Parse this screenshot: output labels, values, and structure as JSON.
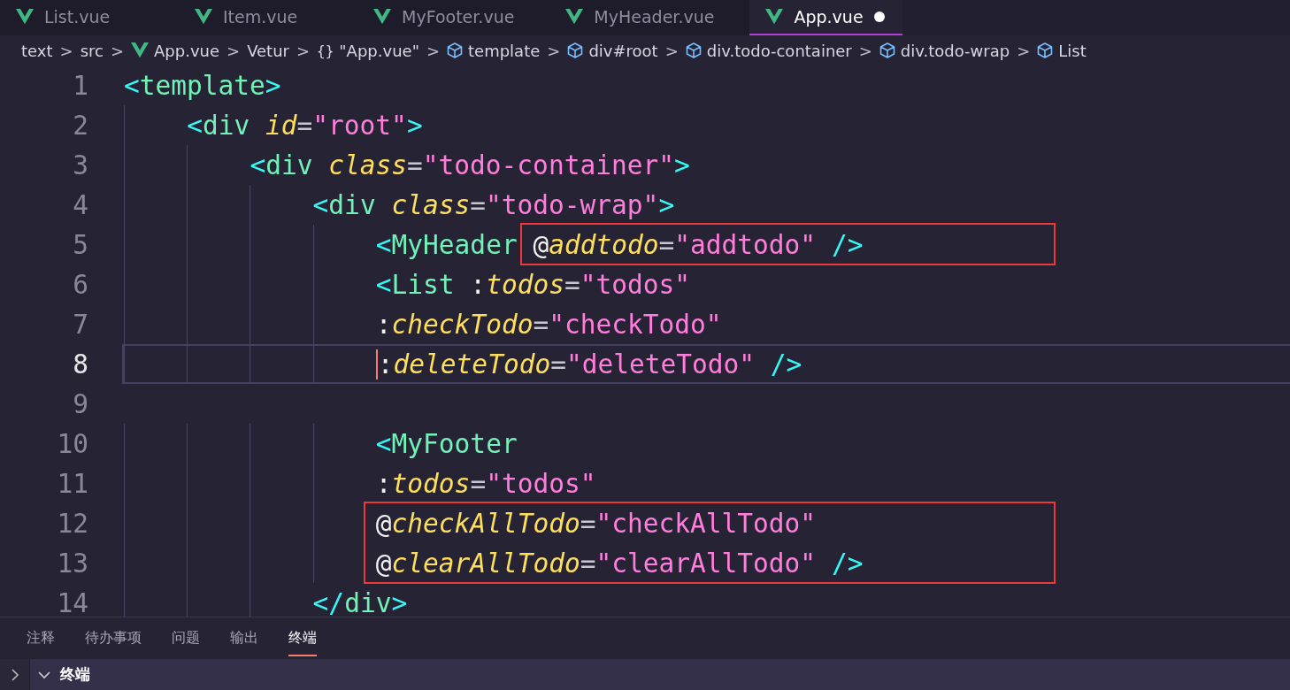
{
  "tabs": [
    {
      "label": "List.vue",
      "selected": false,
      "modified": false
    },
    {
      "label": "Item.vue",
      "selected": false,
      "modified": false
    },
    {
      "label": "MyFooter.vue",
      "selected": false,
      "modified": false
    },
    {
      "label": "MyHeader.vue",
      "selected": false,
      "modified": false
    },
    {
      "label": "App.vue",
      "selected": true,
      "modified": true
    }
  ],
  "breadcrumb": [
    {
      "label": "text",
      "kind": "folder"
    },
    {
      "label": "src",
      "kind": "folder"
    },
    {
      "label": "App.vue",
      "kind": "file"
    },
    {
      "label": "Vetur",
      "kind": "provider"
    },
    {
      "label": "\"App.vue\"",
      "kind": "object"
    },
    {
      "label": "template",
      "kind": "element"
    },
    {
      "label": "div#root",
      "kind": "element"
    },
    {
      "label": "div.todo-container",
      "kind": "element"
    },
    {
      "label": "div.todo-wrap",
      "kind": "element"
    },
    {
      "label": "List",
      "kind": "element"
    }
  ],
  "breadcrumb_separator": ">",
  "braces_icon_text": "{}",
  "editor": {
    "lines": [
      {
        "number": "1",
        "current": false,
        "tokens": [
          {
            "kind": "punct",
            "text": "<"
          },
          {
            "kind": "tag",
            "text": "template"
          },
          {
            "kind": "punct",
            "text": ">"
          }
        ],
        "children": [
          {
            "number": "2",
            "current": false,
            "tokens": [
              {
                "kind": "punct",
                "text": "<"
              },
              {
                "kind": "tag",
                "text": "div"
              },
              {
                "kind": "attr",
                "text": " id"
              },
              {
                "kind": "eq",
                "text": "="
              },
              {
                "kind": "str",
                "text": "\"root\""
              },
              {
                "kind": "punct",
                "text": ">"
              }
            ],
            "children": [
              {
                "number": "3",
                "current": false,
                "tokens": [
                  {
                    "kind": "punct",
                    "text": "<"
                  },
                  {
                    "kind": "tag",
                    "text": "div"
                  },
                  {
                    "kind": "attr",
                    "text": " class"
                  },
                  {
                    "kind": "eq",
                    "text": "="
                  },
                  {
                    "kind": "str",
                    "text": "\"todo-container\""
                  },
                  {
                    "kind": "punct",
                    "text": ">"
                  }
                ],
                "children": [
                  {
                    "number": "4",
                    "current": false,
                    "tokens": [
                      {
                        "kind": "punct",
                        "text": "<"
                      },
                      {
                        "kind": "tag",
                        "text": "div"
                      },
                      {
                        "kind": "attr",
                        "text": " class"
                      },
                      {
                        "kind": "eq",
                        "text": "="
                      },
                      {
                        "kind": "str",
                        "text": "\"todo-wrap\""
                      },
                      {
                        "kind": "punct",
                        "text": ">"
                      }
                    ],
                    "children": [
                      {
                        "number": "5",
                        "current": false,
                        "boxed": true,
                        "tokens": [
                          {
                            "kind": "punct",
                            "text": "<"
                          },
                          {
                            "kind": "tag",
                            "text": "MyHeader "
                          },
                          {
                            "kind": "at",
                            "text": "@"
                          },
                          {
                            "kind": "attr",
                            "text": "addtodo"
                          },
                          {
                            "kind": "eq",
                            "text": "="
                          },
                          {
                            "kind": "str",
                            "text": "\"addtodo\""
                          },
                          {
                            "kind": "punct",
                            "text": " />"
                          }
                        ]
                      },
                      {
                        "number": "6",
                        "current": false,
                        "tokens": [
                          {
                            "kind": "punct",
                            "text": "<"
                          },
                          {
                            "kind": "tag",
                            "text": "List"
                          },
                          {
                            "kind": "at",
                            "text": " :"
                          },
                          {
                            "kind": "attr",
                            "text": "todos"
                          },
                          {
                            "kind": "eq",
                            "text": "="
                          },
                          {
                            "kind": "str",
                            "text": "\"todos\""
                          }
                        ]
                      },
                      {
                        "number": "7",
                        "current": false,
                        "tokens": [
                          {
                            "kind": "at",
                            "text": ":"
                          },
                          {
                            "kind": "attr",
                            "text": "checkTodo"
                          },
                          {
                            "kind": "eq",
                            "text": "="
                          },
                          {
                            "kind": "str",
                            "text": "\"checkTodo\""
                          }
                        ]
                      },
                      {
                        "number": "8",
                        "current": true,
                        "tokens": [
                          {
                            "kind": "at",
                            "text": ":",
                            "cursor": true
                          },
                          {
                            "kind": "attr",
                            "text": "deleteTodo"
                          },
                          {
                            "kind": "eq",
                            "text": "="
                          },
                          {
                            "kind": "str",
                            "text": "\"deleteTodo\""
                          },
                          {
                            "kind": "punct",
                            "text": " />"
                          }
                        ]
                      },
                      {
                        "number": "9",
                        "current": false
                      },
                      {
                        "number": "10",
                        "current": false,
                        "tokens": [
                          {
                            "kind": "punct",
                            "text": "<"
                          },
                          {
                            "kind": "tag",
                            "text": "MyFooter"
                          }
                        ]
                      },
                      {
                        "number": "11",
                        "current": false,
                        "tokens": [
                          {
                            "kind": "at",
                            "text": ":"
                          },
                          {
                            "kind": "attr",
                            "text": "todos"
                          },
                          {
                            "kind": "eq",
                            "text": "="
                          },
                          {
                            "kind": "str",
                            "text": "\"todos\""
                          }
                        ]
                      },
                      {
                        "number": "12",
                        "current": false,
                        "boxed": true,
                        "tokens": [
                          {
                            "kind": "at",
                            "text": "@"
                          },
                          {
                            "kind": "attr",
                            "text": "checkAllTodo"
                          },
                          {
                            "kind": "eq",
                            "text": "="
                          },
                          {
                            "kind": "str",
                            "text": "\"checkAllTodo\""
                          }
                        ]
                      },
                      {
                        "number": "13",
                        "current": false,
                        "boxed": true,
                        "tokens": [
                          {
                            "kind": "at",
                            "text": "@"
                          },
                          {
                            "kind": "attr",
                            "text": "clearAllTodo"
                          },
                          {
                            "kind": "eq",
                            "text": "="
                          },
                          {
                            "kind": "str",
                            "text": "\"clearAllTodo\""
                          },
                          {
                            "kind": "punct",
                            "text": " />"
                          }
                        ]
                      }
                    ]
                  },
                  {
                    "number": "14",
                    "current": false,
                    "tokens": [
                      {
                        "kind": "punct",
                        "text": "</"
                      },
                      {
                        "kind": "tag",
                        "text": "div"
                      },
                      {
                        "kind": "punct",
                        "text": ">"
                      }
                    ]
                  }
                ]
              }
            ]
          }
        ]
      }
    ]
  },
  "panel": {
    "tabs": [
      {
        "label": "注释",
        "selected": false
      },
      {
        "label": "待办事项",
        "selected": false
      },
      {
        "label": "问题",
        "selected": false
      },
      {
        "label": "输出",
        "selected": false
      },
      {
        "label": "终端",
        "selected": true
      }
    ],
    "section": {
      "title": "终端",
      "expanded": true
    }
  }
}
